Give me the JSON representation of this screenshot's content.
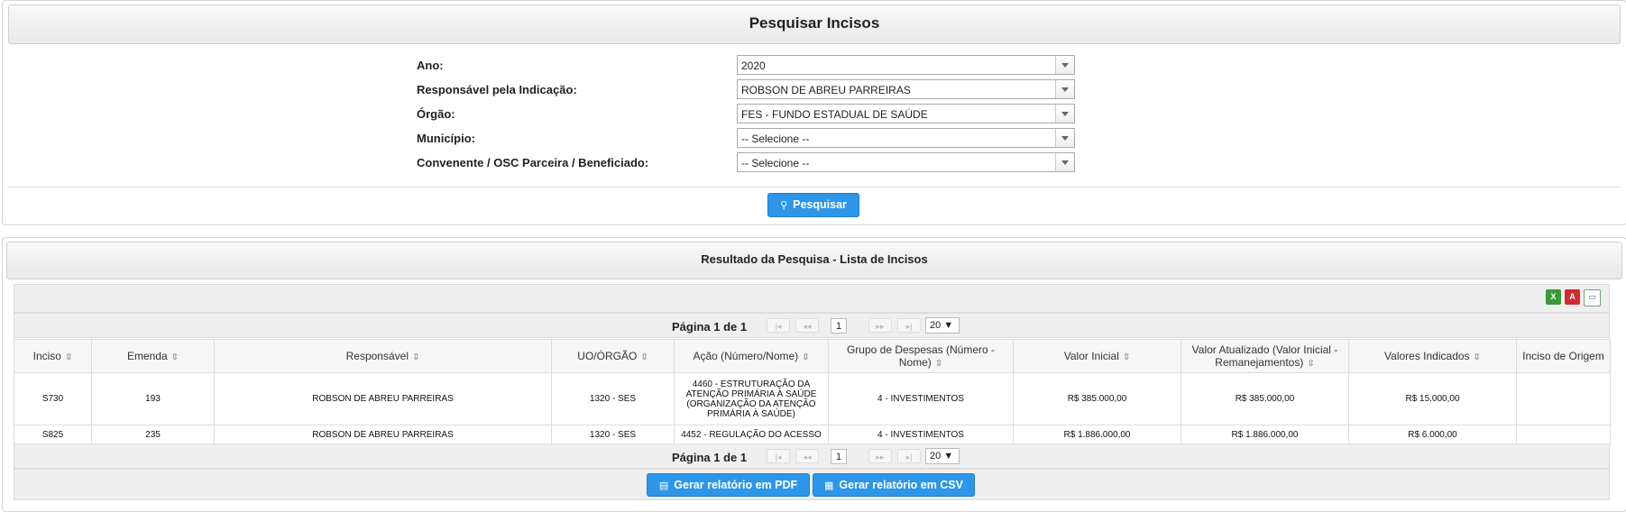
{
  "search": {
    "title": "Pesquisar Incisos",
    "fields": [
      {
        "label": "Ano:",
        "value": "2020"
      },
      {
        "label": "Responsável pela Indicação:",
        "value": "ROBSON DE ABREU PARREIRAS"
      },
      {
        "label": "Órgão:",
        "value": "FES - FUNDO ESTADUAL DE SAÚDE"
      },
      {
        "label": "Município:",
        "value": "-- Selecione --"
      },
      {
        "label": "Convenente / OSC Parceira / Beneficiado:",
        "value": "-- Selecione --"
      }
    ],
    "button_label": "Pesquisar"
  },
  "results": {
    "title": "Resultado da Pesquisa - Lista de Incisos",
    "export_icons": [
      "excel-icon",
      "pdf-icon",
      "print-icon"
    ],
    "pager": {
      "text": "Página 1 de 1",
      "page": "1",
      "page_size": "20 ▼"
    },
    "columns": [
      "Inciso",
      "Emenda",
      "Responsável",
      "UO/ÓRGÃO",
      "Ação (Número/Nome)",
      "Grupo de Despesas (Número - Nome)",
      "Valor Inicial",
      "Valor Atualizado (Valor Inicial - Remanejamentos)",
      "Valores Indicados",
      "Inciso de Origem"
    ],
    "rows": [
      [
        "S730",
        "193",
        "ROBSON DE ABREU PARREIRAS",
        "1320 - SES",
        "4460 - ESTRUTURAÇÃO DA ATENÇÃO PRIMÁRIA À SAÚDE (ORGANIZAÇÃO DA ATENÇÃO PRIMÁRIA À SAÚDE)",
        "4 - INVESTIMENTOS",
        "R$ 385.000,00",
        "R$ 385.000,00",
        "R$ 15.000,00",
        ""
      ],
      [
        "S825",
        "235",
        "ROBSON DE ABREU PARREIRAS",
        "1320 - SES",
        "4452 - REGULAÇÃO DO ACESSO",
        "4 - INVESTIMENTOS",
        "R$ 1.886.000,00",
        "R$ 1.886.000,00",
        "R$ 6.000,00",
        ""
      ]
    ],
    "pdf_button": "Gerar relatório em PDF",
    "csv_button": "Gerar relatório em CSV"
  },
  "colors": {
    "accent": "#2d96e8",
    "excel": "#3a9a3a",
    "pdf": "#d22b2b"
  }
}
